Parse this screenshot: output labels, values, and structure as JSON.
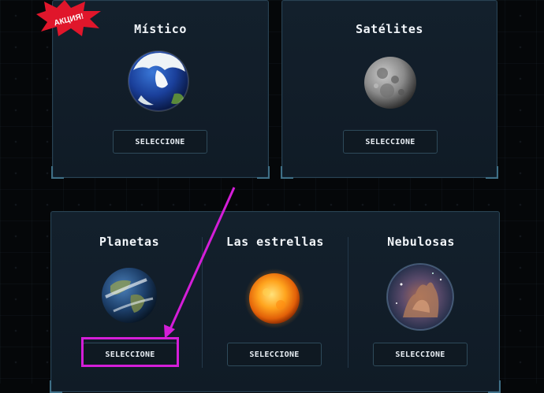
{
  "badge": {
    "text": "АКЦИЯ!",
    "color": "#e0162b"
  },
  "top_cards": [
    {
      "title": "Místico",
      "button": "SELECCIONE",
      "image": "snow-earth-globe"
    },
    {
      "title": "Satélites",
      "button": "SELECCIONE",
      "image": "moon"
    }
  ],
  "bottom_card": {
    "items": [
      {
        "title": "Planetas",
        "button": "SELECCIONE",
        "image": "earth-planet"
      },
      {
        "title": "Las estrellas",
        "button": "SELECCIONE",
        "image": "sun-star"
      },
      {
        "title": "Nebulosas",
        "button": "SELECCIONE",
        "image": "nebula"
      }
    ]
  },
  "annotation": {
    "color": "#d41ed8",
    "target": "Planetas select button"
  }
}
